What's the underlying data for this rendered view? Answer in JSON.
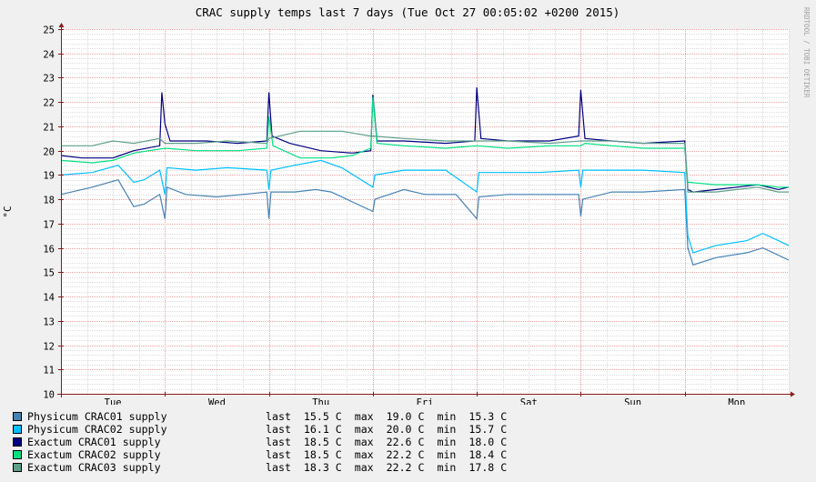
{
  "title": "CRAC supply temps last 7 days (Tue Oct 27 00:05:02 +0200 2015)",
  "watermark": "RRDTOOL / TOBI OETIKER",
  "colors": {
    "background": "#f0f0f0",
    "plot_background": "#ffffff",
    "major_grid": "#e8a0a0",
    "minor_grid": "#dcdcdc",
    "axis": "#8b1a1a"
  },
  "stat_labels": {
    "last": "last",
    "max": "max",
    "min": "min"
  },
  "chart_data": {
    "type": "line",
    "title": "CRAC supply temps last 7 days (Tue Oct 27 00:05:02 +0200 2015)",
    "ylabel": "°C",
    "xlabel": "",
    "ylim": [
      10,
      25
    ],
    "y_ticks": [
      10,
      11,
      12,
      13,
      14,
      15,
      16,
      17,
      18,
      19,
      20,
      21,
      22,
      23,
      24,
      25
    ],
    "x_range": [
      0,
      7
    ],
    "x_unit": "days",
    "x_ticks": [
      {
        "label": "Tue",
        "x": 0.5
      },
      {
        "label": "Wed",
        "x": 1.5
      },
      {
        "label": "Thu",
        "x": 2.5
      },
      {
        "label": "Fri",
        "x": 3.5
      },
      {
        "label": "Sat",
        "x": 4.5
      },
      {
        "label": "Sun",
        "x": 5.5
      },
      {
        "label": "Mon",
        "x": 6.5
      }
    ],
    "day_boundaries": [
      1,
      2,
      3,
      4,
      5,
      6
    ],
    "grid": true,
    "legend_position": "bottom",
    "series": [
      {
        "name": "Physicum CRAC01 supply",
        "color": "#4682b4",
        "last": "15.5 C",
        "max": "19.0 C",
        "min": "15.3 C",
        "points": [
          [
            0,
            18.2
          ],
          [
            0.3,
            18.5
          ],
          [
            0.55,
            18.8
          ],
          [
            0.7,
            17.7
          ],
          [
            0.8,
            17.8
          ],
          [
            0.95,
            18.2
          ],
          [
            1.0,
            17.2
          ],
          [
            1.02,
            18.5
          ],
          [
            1.2,
            18.2
          ],
          [
            1.5,
            18.1
          ],
          [
            1.75,
            18.2
          ],
          [
            1.98,
            18.3
          ],
          [
            2.0,
            17.2
          ],
          [
            2.02,
            18.3
          ],
          [
            2.25,
            18.3
          ],
          [
            2.45,
            18.4
          ],
          [
            2.6,
            18.3
          ],
          [
            3.0,
            17.5
          ],
          [
            3.02,
            18.0
          ],
          [
            3.3,
            18.4
          ],
          [
            3.5,
            18.2
          ],
          [
            3.8,
            18.2
          ],
          [
            4.0,
            17.2
          ],
          [
            4.02,
            18.1
          ],
          [
            4.3,
            18.2
          ],
          [
            4.6,
            18.2
          ],
          [
            4.98,
            18.2
          ],
          [
            5.0,
            17.3
          ],
          [
            5.02,
            18.0
          ],
          [
            5.3,
            18.3
          ],
          [
            5.6,
            18.3
          ],
          [
            6.0,
            18.4
          ],
          [
            6.03,
            16.0
          ],
          [
            6.08,
            15.3
          ],
          [
            6.3,
            15.6
          ],
          [
            6.6,
            15.8
          ],
          [
            6.75,
            16.0
          ],
          [
            6.9,
            15.7
          ],
          [
            7.0,
            15.5
          ]
        ]
      },
      {
        "name": "Physicum CRAC02 supply",
        "color": "#00bfff",
        "last": "16.1 C",
        "max": "20.0 C",
        "min": "15.7 C",
        "points": [
          [
            0,
            19.0
          ],
          [
            0.3,
            19.1
          ],
          [
            0.55,
            19.4
          ],
          [
            0.7,
            18.7
          ],
          [
            0.8,
            18.8
          ],
          [
            0.95,
            19.2
          ],
          [
            1.0,
            18.2
          ],
          [
            1.02,
            19.3
          ],
          [
            1.3,
            19.2
          ],
          [
            1.6,
            19.3
          ],
          [
            1.98,
            19.2
          ],
          [
            2.0,
            18.4
          ],
          [
            2.02,
            19.2
          ],
          [
            2.25,
            19.4
          ],
          [
            2.5,
            19.6
          ],
          [
            2.7,
            19.3
          ],
          [
            3.0,
            18.5
          ],
          [
            3.02,
            19.0
          ],
          [
            3.3,
            19.2
          ],
          [
            3.7,
            19.2
          ],
          [
            4.0,
            18.3
          ],
          [
            4.02,
            19.1
          ],
          [
            4.3,
            19.1
          ],
          [
            4.6,
            19.1
          ],
          [
            4.98,
            19.2
          ],
          [
            5.0,
            18.5
          ],
          [
            5.02,
            19.2
          ],
          [
            5.3,
            19.2
          ],
          [
            5.6,
            19.2
          ],
          [
            6.0,
            19.1
          ],
          [
            6.03,
            16.5
          ],
          [
            6.08,
            15.8
          ],
          [
            6.3,
            16.1
          ],
          [
            6.6,
            16.3
          ],
          [
            6.75,
            16.6
          ],
          [
            6.9,
            16.3
          ],
          [
            7.0,
            16.1
          ]
        ]
      },
      {
        "name": "Exactum CRAC01 supply",
        "color": "#000080",
        "last": "18.5 C",
        "max": "22.6 C",
        "min": "18.0 C",
        "points": [
          [
            0,
            19.8
          ],
          [
            0.2,
            19.7
          ],
          [
            0.5,
            19.7
          ],
          [
            0.7,
            20.0
          ],
          [
            0.95,
            20.2
          ],
          [
            0.97,
            22.4
          ],
          [
            1.0,
            21.1
          ],
          [
            1.05,
            20.4
          ],
          [
            1.4,
            20.4
          ],
          [
            1.7,
            20.3
          ],
          [
            1.98,
            20.4
          ],
          [
            2.0,
            22.4
          ],
          [
            2.03,
            20.6
          ],
          [
            2.2,
            20.3
          ],
          [
            2.5,
            20.0
          ],
          [
            2.8,
            19.9
          ],
          [
            2.98,
            20.0
          ],
          [
            3.0,
            22.3
          ],
          [
            3.04,
            20.4
          ],
          [
            3.3,
            20.4
          ],
          [
            3.7,
            20.3
          ],
          [
            3.98,
            20.4
          ],
          [
            4.0,
            22.6
          ],
          [
            4.04,
            20.5
          ],
          [
            4.3,
            20.4
          ],
          [
            4.7,
            20.4
          ],
          [
            4.98,
            20.6
          ],
          [
            5.0,
            22.5
          ],
          [
            5.04,
            20.5
          ],
          [
            5.3,
            20.4
          ],
          [
            5.6,
            20.3
          ],
          [
            6.0,
            20.4
          ],
          [
            6.03,
            18.4
          ],
          [
            6.08,
            18.3
          ],
          [
            6.3,
            18.4
          ],
          [
            6.5,
            18.5
          ],
          [
            6.7,
            18.6
          ],
          [
            6.9,
            18.4
          ],
          [
            7.0,
            18.5
          ]
        ]
      },
      {
        "name": "Exactum CRAC02 supply",
        "color": "#00e080",
        "last": "18.5 C",
        "max": "22.2 C",
        "min": "18.4 C",
        "points": [
          [
            0,
            19.6
          ],
          [
            0.3,
            19.5
          ],
          [
            0.5,
            19.6
          ],
          [
            0.7,
            19.9
          ],
          [
            1.0,
            20.1
          ],
          [
            1.3,
            20.0
          ],
          [
            1.7,
            20.0
          ],
          [
            1.98,
            20.1
          ],
          [
            2.0,
            21.4
          ],
          [
            2.04,
            20.2
          ],
          [
            2.3,
            19.7
          ],
          [
            2.6,
            19.7
          ],
          [
            2.8,
            19.8
          ],
          [
            2.98,
            20.1
          ],
          [
            3.0,
            22.2
          ],
          [
            3.04,
            20.3
          ],
          [
            3.3,
            20.2
          ],
          [
            3.7,
            20.1
          ],
          [
            4.0,
            20.2
          ],
          [
            4.3,
            20.1
          ],
          [
            4.7,
            20.2
          ],
          [
            5.0,
            20.2
          ],
          [
            5.04,
            20.3
          ],
          [
            5.3,
            20.2
          ],
          [
            5.6,
            20.1
          ],
          [
            6.0,
            20.1
          ],
          [
            6.03,
            18.7
          ],
          [
            6.3,
            18.6
          ],
          [
            6.5,
            18.6
          ],
          [
            6.7,
            18.6
          ],
          [
            6.9,
            18.5
          ],
          [
            7.0,
            18.5
          ]
        ]
      },
      {
        "name": "Exactum CRAC03 supply",
        "color": "#5f9e8a",
        "last": "18.3 C",
        "max": "22.2 C",
        "min": "17.8 C",
        "points": [
          [
            0,
            20.2
          ],
          [
            0.3,
            20.2
          ],
          [
            0.5,
            20.4
          ],
          [
            0.7,
            20.3
          ],
          [
            0.95,
            20.5
          ],
          [
            1.0,
            20.3
          ],
          [
            1.3,
            20.3
          ],
          [
            1.6,
            20.4
          ],
          [
            1.98,
            20.3
          ],
          [
            2.0,
            20.5
          ],
          [
            2.3,
            20.8
          ],
          [
            2.5,
            20.8
          ],
          [
            2.7,
            20.8
          ],
          [
            2.98,
            20.6
          ],
          [
            3.0,
            20.6
          ],
          [
            3.3,
            20.5
          ],
          [
            3.7,
            20.4
          ],
          [
            4.0,
            20.4
          ],
          [
            4.3,
            20.4
          ],
          [
            4.7,
            20.3
          ],
          [
            5.0,
            20.4
          ],
          [
            5.3,
            20.4
          ],
          [
            5.6,
            20.3
          ],
          [
            6.0,
            20.3
          ],
          [
            6.03,
            18.3
          ],
          [
            6.3,
            18.3
          ],
          [
            6.5,
            18.4
          ],
          [
            6.7,
            18.5
          ],
          [
            6.9,
            18.3
          ],
          [
            7.0,
            18.3
          ]
        ]
      }
    ]
  }
}
